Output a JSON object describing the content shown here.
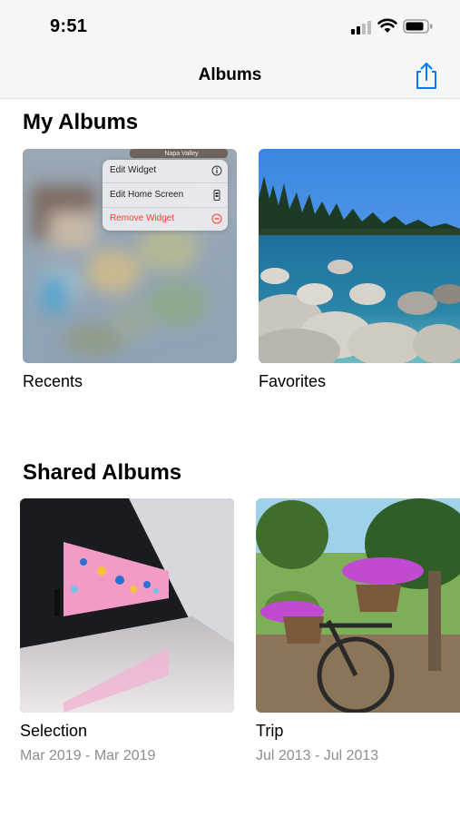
{
  "status": {
    "time": "9:51"
  },
  "nav": {
    "title": "Albums"
  },
  "sections": {
    "my_albums": "My Albums",
    "shared_albums": "Shared Albums"
  },
  "my_albums": [
    {
      "title": "Recents"
    },
    {
      "title": "Favorites"
    }
  ],
  "recents_thumb": {
    "widget_label": "Napa Valley",
    "menu": [
      "Edit Widget",
      "Edit Home Screen",
      "Remove Widget"
    ]
  },
  "shared_albums": [
    {
      "title": "Selection",
      "dates": "Mar 2019 - Mar 2019"
    },
    {
      "title": "Trip",
      "dates": "Jul 2013 - Jul 2013"
    }
  ],
  "colors": {
    "accent": "#007aff",
    "destructive": "#ff3b30",
    "secondary_text": "#8e8e93",
    "bar_background": "#f6f6f7"
  }
}
